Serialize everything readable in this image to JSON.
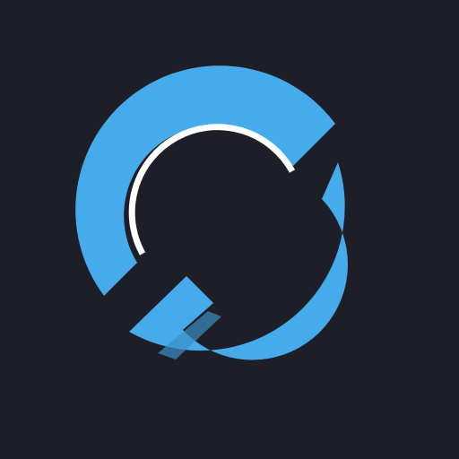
{
  "logo": {
    "icon": "circular-c-logo-icon",
    "colors": {
      "background": "#1d1e27",
      "ring": "#46abeb",
      "ring_shadow": "#3a8fc6",
      "inner_arc": "#ffffff"
    }
  }
}
